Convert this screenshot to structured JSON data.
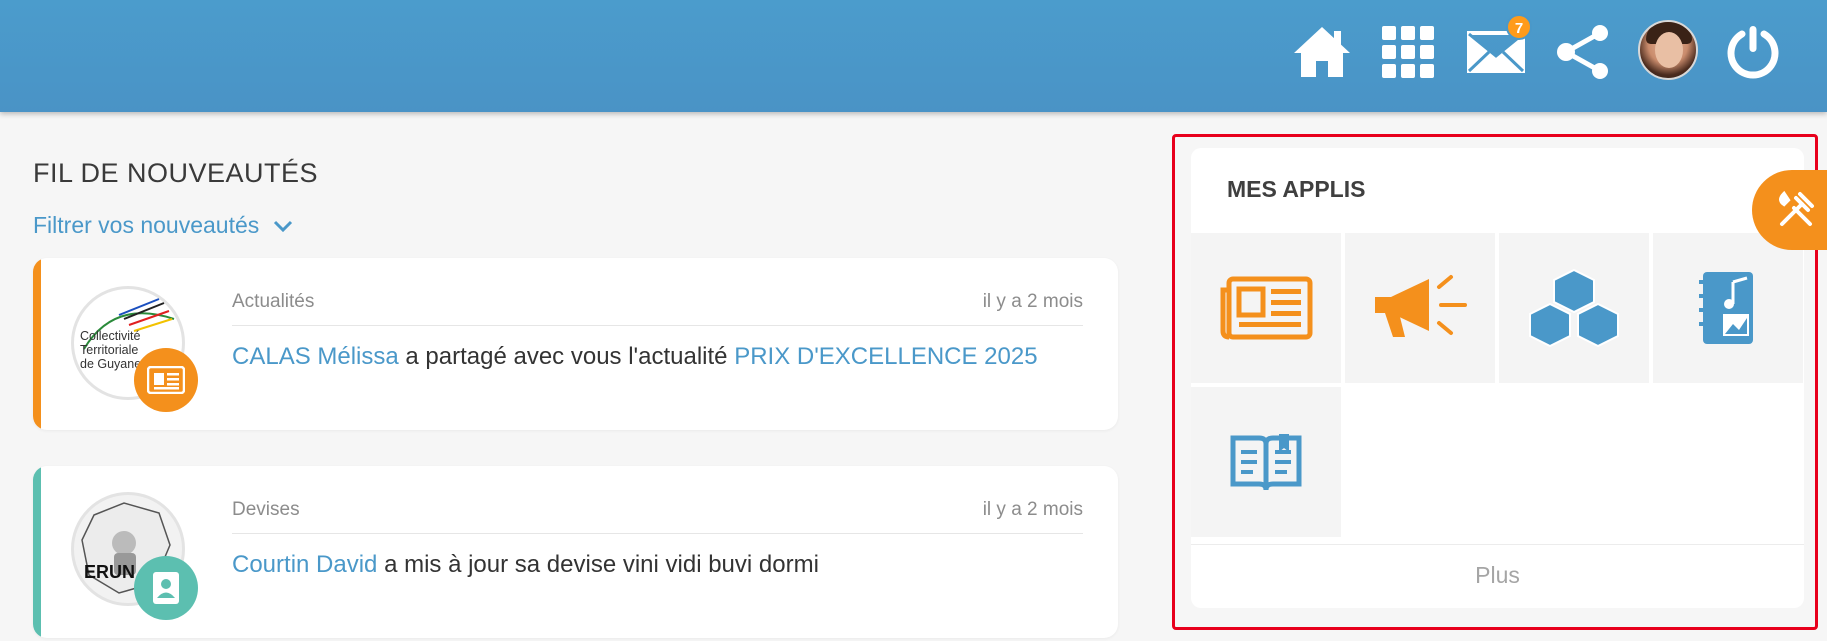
{
  "header": {
    "mail_badge_count": "7",
    "icons": [
      "home-icon",
      "apps-grid-icon",
      "mail-icon",
      "share-icon",
      "avatar",
      "power-icon"
    ]
  },
  "feed": {
    "title": "FIL DE NOUVEAUTÉS",
    "filter_label": "Filtrer vos nouveautés",
    "items": [
      {
        "category": "Actualités",
        "time": "il y a 2 mois",
        "author": "CALAS Mélissa",
        "action": " a partagé avec vous l'actualité ",
        "target": "PRIX D'EXCELLENCE 2025",
        "accent_color": "#f4901c",
        "badge_color": "#f4901c",
        "badge_icon": "newspaper-icon",
        "logo_text": "Collectivité Territoriale de Guyane"
      },
      {
        "category": "Devises",
        "time": "il y a 2 mois",
        "author": "Courtin David",
        "action": " a mis à jour sa devise vini vidi buvi dormi",
        "target": "",
        "accent_color": "#5cbfb0",
        "badge_color": "#5cbfb0",
        "badge_icon": "contact-card-icon",
        "logo_text": "ERUN"
      }
    ]
  },
  "apps": {
    "title": "MES APPLIS",
    "tiles": [
      {
        "name": "newspaper-app",
        "icon": "newspaper-icon",
        "color": "#f4901c"
      },
      {
        "name": "megaphone-app",
        "icon": "megaphone-icon",
        "color": "#f4901c"
      },
      {
        "name": "cubes-app",
        "icon": "cubes-icon",
        "color": "#4a98c9"
      },
      {
        "name": "music-notebook-app",
        "icon": "music-notebook-icon",
        "color": "#4a98c9"
      },
      {
        "name": "book-app",
        "icon": "open-book-icon",
        "color": "#4a98c9"
      }
    ],
    "more_label": "Plus"
  },
  "colors": {
    "header_blue": "#4a98c9",
    "accent_orange": "#f4901c",
    "accent_teal": "#5cbfb0",
    "highlight_red": "#e8001c"
  }
}
